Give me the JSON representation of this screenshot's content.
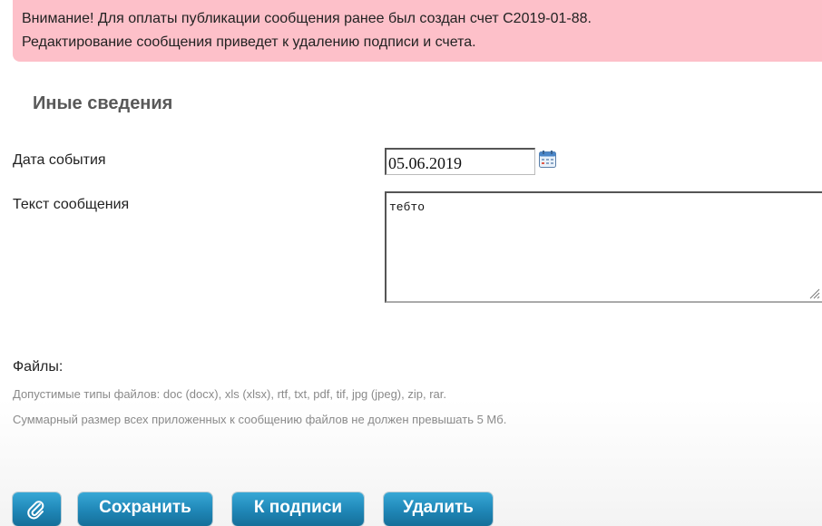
{
  "alert": {
    "line1": "Внимание! Для оплаты публикации сообщения ранее был создан счет С2019-01-88.",
    "line2": "Редактирование сообщения приведет к удалению подписи и счета."
  },
  "section": {
    "title": "Иные сведения"
  },
  "form": {
    "event_date_label": "Дата события",
    "event_date_value": "05.06.2019",
    "message_text_label": "Текст сообщения",
    "message_text_value": "тебто"
  },
  "files": {
    "label": "Файлы:",
    "allowed_types_hint": "Допустимые типы файлов: doc (docx), xls (xlsx), rtf, txt, pdf, tif, jpg (jpeg), zip, rar.",
    "size_limit_hint": "Суммарный размер всех приложенных к сообщению файлов не должен превышать 5 Мб."
  },
  "buttons": {
    "attach_icon": "paperclip-icon",
    "save_label": "Сохранить",
    "sign_label": "К подписи",
    "delete_label": "Удалить"
  },
  "colors": {
    "alert_bg": "#fdc0c9",
    "button_accent": "#1f86b6",
    "section_title": "#595959"
  }
}
